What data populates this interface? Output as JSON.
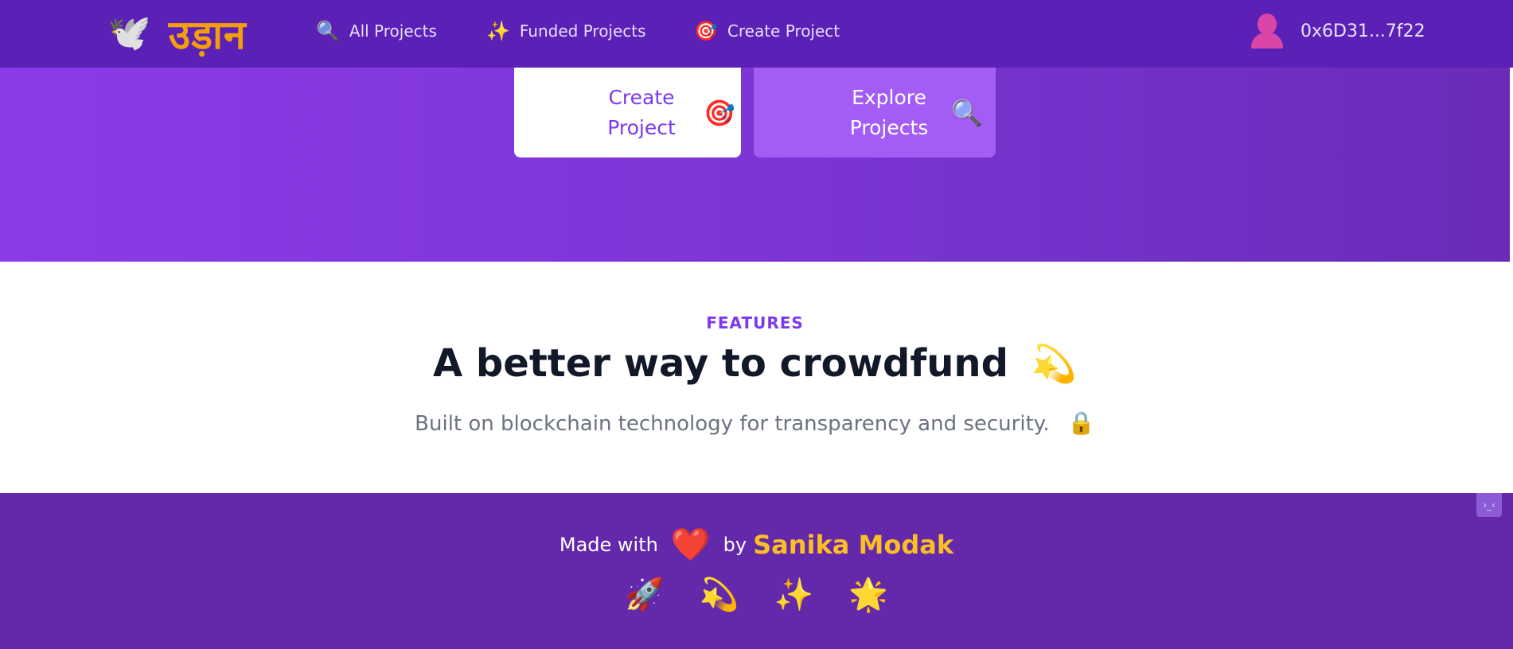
{
  "nav": {
    "logo_icon": "🕊️",
    "logo_text": "उड़ान",
    "links": [
      {
        "icon": "🔍",
        "label": "All Projects"
      },
      {
        "icon": "✨",
        "label": "Funded Projects"
      },
      {
        "icon": "🎯",
        "label": "Create Project"
      }
    ],
    "wallet_address": "0x6D31...7f22"
  },
  "hero": {
    "create_button": {
      "label_line1": "Create",
      "label_line2": "Project",
      "icon": "🎯"
    },
    "explore_button": {
      "label_line1": "Explore",
      "label_line2": "Projects",
      "icon": "🔍"
    }
  },
  "features": {
    "eyebrow": "FEATURES",
    "title": "A better way to crowdfund",
    "title_icon": "💫",
    "subtitle": "Built on blockchain technology for transparency and security.",
    "subtitle_icon": "🔒"
  },
  "footer": {
    "made_with": "Made with",
    "heart_icon": "❤️",
    "by": "by",
    "author": "Sanika Modak",
    "icons": [
      "🚀",
      "💫",
      "✨",
      "🌟"
    ],
    "corner_tab_icon": "›_‹"
  },
  "colors": {
    "nav_bg": "#5b21b6",
    "hero_gradient_start": "#8b3be8",
    "hero_gradient_end": "#6b2bb8",
    "accent_purple": "#7c3aed",
    "logo_orange": "#f59e0b",
    "author_yellow": "#fbbf24",
    "footer_bg": "#6428aa"
  }
}
